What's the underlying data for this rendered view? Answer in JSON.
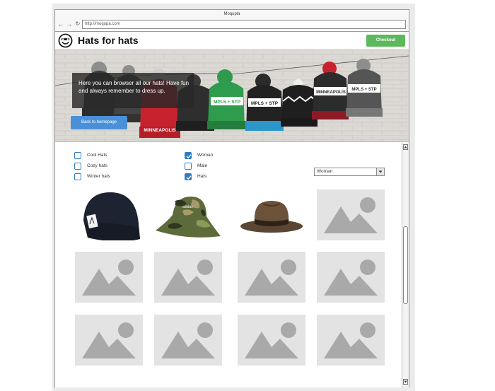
{
  "browser": {
    "title": "Moqupla",
    "url": "http://moqupa.com",
    "back_icon": "back-arrow-icon",
    "forward_icon": "forward-arrow-icon",
    "reload_icon": "reload-icon"
  },
  "header": {
    "site_title": "Hats for hats",
    "logo_icon": "smiley-face-icon",
    "checkout_label": "Checkout",
    "checkout_color": "#5cb85c"
  },
  "hero": {
    "text": "Here you can browser all our hats! Have fun and always remember to dress up.",
    "back_button_label": "Back to homepage",
    "back_button_color": "#4a90d9",
    "hat_labels": [
      "MINNEAPOLIS",
      "MPLS + STP",
      "MPLS + STP",
      "MINNEAPOLIS",
      "MPLS + STP"
    ]
  },
  "filters": {
    "left": [
      {
        "label": "Cool Hats",
        "checked": false
      },
      {
        "label": "Cozy hats",
        "checked": false
      },
      {
        "label": "Winter hats",
        "checked": false
      }
    ],
    "right": [
      {
        "label": "Woman",
        "checked": true
      },
      {
        "label": "Male",
        "checked": false
      },
      {
        "label": "Hats",
        "checked": true
      }
    ]
  },
  "sort_select": {
    "value": "Woman"
  },
  "products": [
    {
      "type": "beanie",
      "icon": "beanie-hat-image"
    },
    {
      "type": "bucket",
      "icon": "camo-bucket-hat-image"
    },
    {
      "type": "fedora",
      "icon": "fedora-hat-image"
    },
    {
      "type": "placeholder",
      "icon": "image-placeholder-icon"
    },
    {
      "type": "placeholder",
      "icon": "image-placeholder-icon"
    },
    {
      "type": "placeholder",
      "icon": "image-placeholder-icon"
    },
    {
      "type": "placeholder",
      "icon": "image-placeholder-icon"
    },
    {
      "type": "placeholder",
      "icon": "image-placeholder-icon"
    },
    {
      "type": "placeholder",
      "icon": "image-placeholder-icon"
    },
    {
      "type": "placeholder",
      "icon": "image-placeholder-icon"
    },
    {
      "type": "placeholder",
      "icon": "image-placeholder-icon"
    },
    {
      "type": "placeholder",
      "icon": "image-placeholder-icon"
    }
  ],
  "colors": {
    "checkbox_accent": "#2f7cc1",
    "placeholder_bg": "#e3e3e3",
    "placeholder_shape": "#a9a9a9"
  }
}
